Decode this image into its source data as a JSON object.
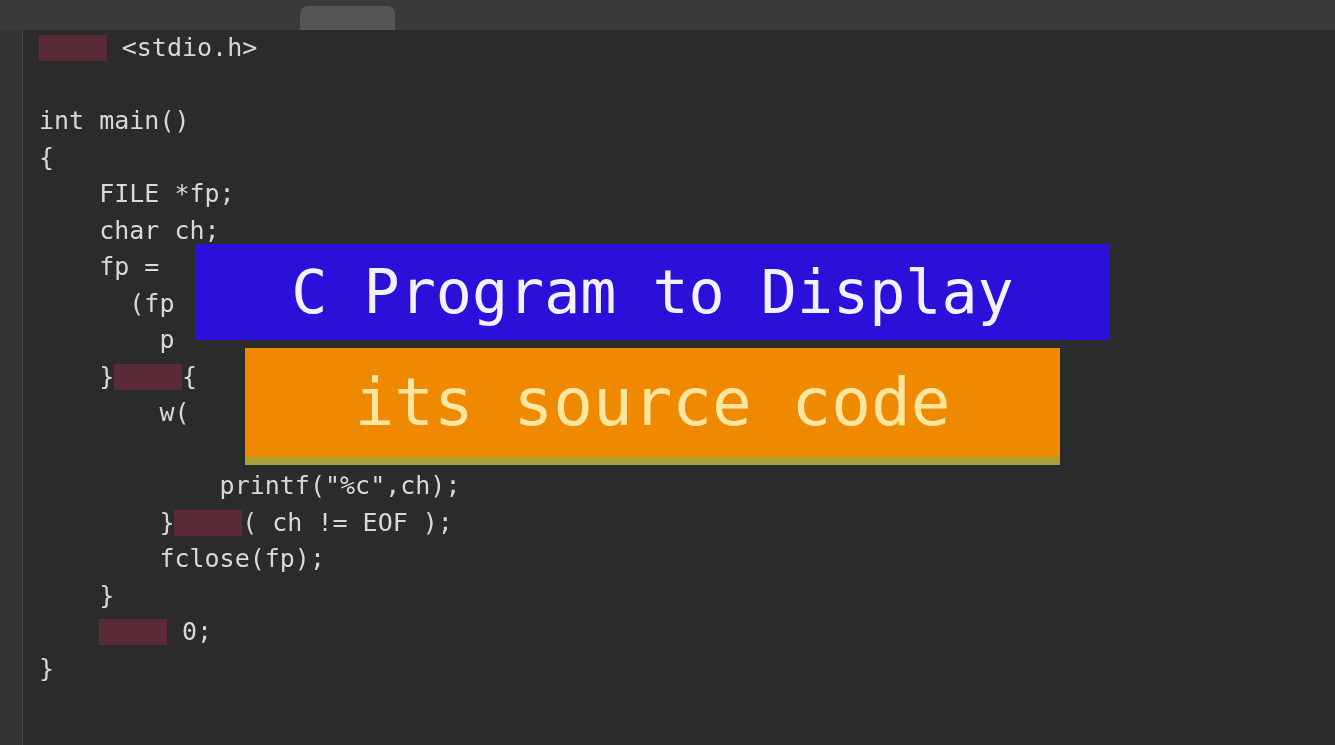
{
  "editor": {
    "lines": [
      {
        "kind": "code",
        "tokens": [
          {
            "kind": "blur"
          },
          {
            "kind": "text",
            "text": " <stdio.h>"
          }
        ]
      },
      {
        "kind": "blank"
      },
      {
        "kind": "code",
        "tokens": [
          {
            "kind": "text",
            "text": "int main()"
          }
        ]
      },
      {
        "kind": "code",
        "tokens": [
          {
            "kind": "text",
            "text": "{"
          }
        ]
      },
      {
        "kind": "code",
        "tokens": [
          {
            "kind": "text",
            "text": "    FILE *fp;"
          }
        ]
      },
      {
        "kind": "code",
        "tokens": [
          {
            "kind": "text",
            "text": "    char ch;"
          }
        ]
      },
      {
        "kind": "code",
        "tokens": [
          {
            "kind": "text",
            "text": "    fp ="
          }
        ]
      },
      {
        "kind": "code",
        "tokens": [
          {
            "kind": "text",
            "text": "      (fp"
          }
        ]
      },
      {
        "kind": "code",
        "tokens": [
          {
            "kind": "text",
            "text": "        p"
          }
        ]
      },
      {
        "kind": "code",
        "tokens": [
          {
            "kind": "text",
            "text": "    }"
          },
          {
            "kind": "blur"
          },
          {
            "kind": "text",
            "text": "{"
          }
        ]
      },
      {
        "kind": "code",
        "tokens": [
          {
            "kind": "text",
            "text": "        w("
          }
        ]
      },
      {
        "kind": "blank"
      },
      {
        "kind": "code",
        "tokens": [
          {
            "kind": "text",
            "text": "            printf(\"%c\",ch);"
          }
        ]
      },
      {
        "kind": "code",
        "tokens": [
          {
            "kind": "text",
            "text": "        }"
          },
          {
            "kind": "blur"
          },
          {
            "kind": "text",
            "text": "( ch != EOF );"
          }
        ]
      },
      {
        "kind": "code",
        "tokens": [
          {
            "kind": "text",
            "text": "        fclose(fp);"
          }
        ]
      },
      {
        "kind": "code",
        "tokens": [
          {
            "kind": "text",
            "text": "    }"
          }
        ]
      },
      {
        "kind": "indented",
        "tokens": [
          {
            "kind": "blur"
          },
          {
            "kind": "text",
            "text": " 0;"
          }
        ]
      },
      {
        "kind": "code",
        "tokens": [
          {
            "kind": "text",
            "text": "}"
          }
        ]
      }
    ]
  },
  "banner": {
    "title": "C Program to Display",
    "subtitle": "its source code"
  }
}
